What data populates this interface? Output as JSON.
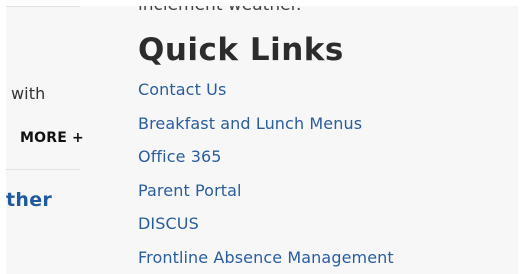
{
  "left_column": {
    "text_fragment": "with",
    "more_label": "MORE +",
    "heading_fragment": "ther"
  },
  "quick_links": {
    "cut_text": "inclement weather.",
    "title": "Quick Links",
    "links": [
      "Contact Us",
      "Breakfast and Lunch Menus",
      "Office 365",
      "Parent Portal",
      "DISCUS",
      "Frontline Absence Management"
    ]
  },
  "colors": {
    "link": "#2a5d9c",
    "heading": "#2c2c2c",
    "accent_heading": "#1e5a9c",
    "panel_background": "#f7f7f7"
  }
}
